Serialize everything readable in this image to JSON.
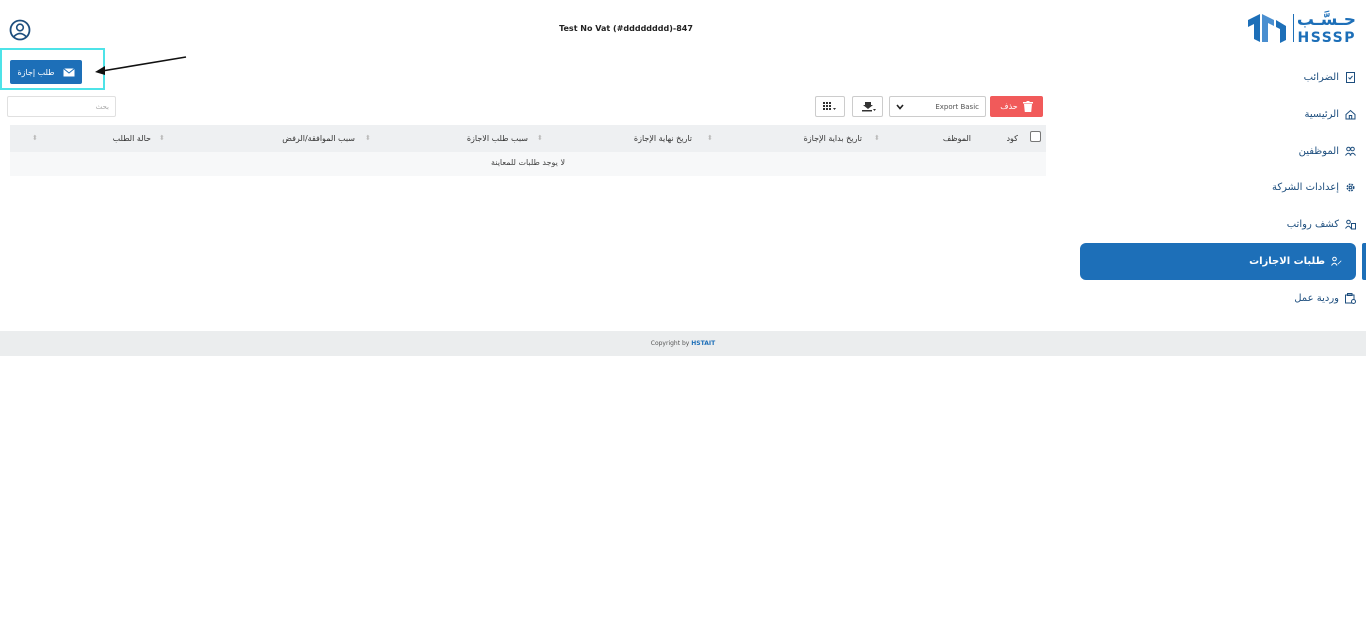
{
  "header": {
    "company": "Test No Vat (#dddddddd)-847",
    "logo_ar": "حـسَّـب",
    "logo_en": "HSSSP"
  },
  "leave_button": {
    "label": "طلب إجازة"
  },
  "toolbar": {
    "search_placeholder": "بحث",
    "export_value": "Export Basic",
    "delete_label": "حذف"
  },
  "table": {
    "columns": [
      "كود",
      "الموظف",
      "تاريخ بداية الإجازة",
      "تاريخ نهاية الإجازة",
      "سبب طلب الاجازة",
      "سبب الموافقة/الرفض",
      "حالة الطلب"
    ],
    "empty_message": "لا يوجد طلبات للمعاينة"
  },
  "sidebar": {
    "items": [
      {
        "label": "الضرائب",
        "icon": "tax-icon"
      },
      {
        "label": "الرئيسية",
        "icon": "home-icon"
      },
      {
        "label": "الموظفين",
        "icon": "employees-icon"
      },
      {
        "label": "إعدادات الشركة",
        "icon": "settings-icon"
      },
      {
        "label": "كشف رواتب",
        "icon": "payroll-icon"
      },
      {
        "label": "طلبات الاجازات",
        "icon": "leave-requests-icon",
        "active": true
      },
      {
        "label": "وردية عمل",
        "icon": "shift-icon"
      }
    ]
  },
  "footer": {
    "prefix": "Copyright by",
    "brand": "HSTAIT"
  },
  "colors": {
    "primary": "#1d6fb8",
    "danger": "#f15a5a",
    "highlight": "#4ee3e8"
  }
}
